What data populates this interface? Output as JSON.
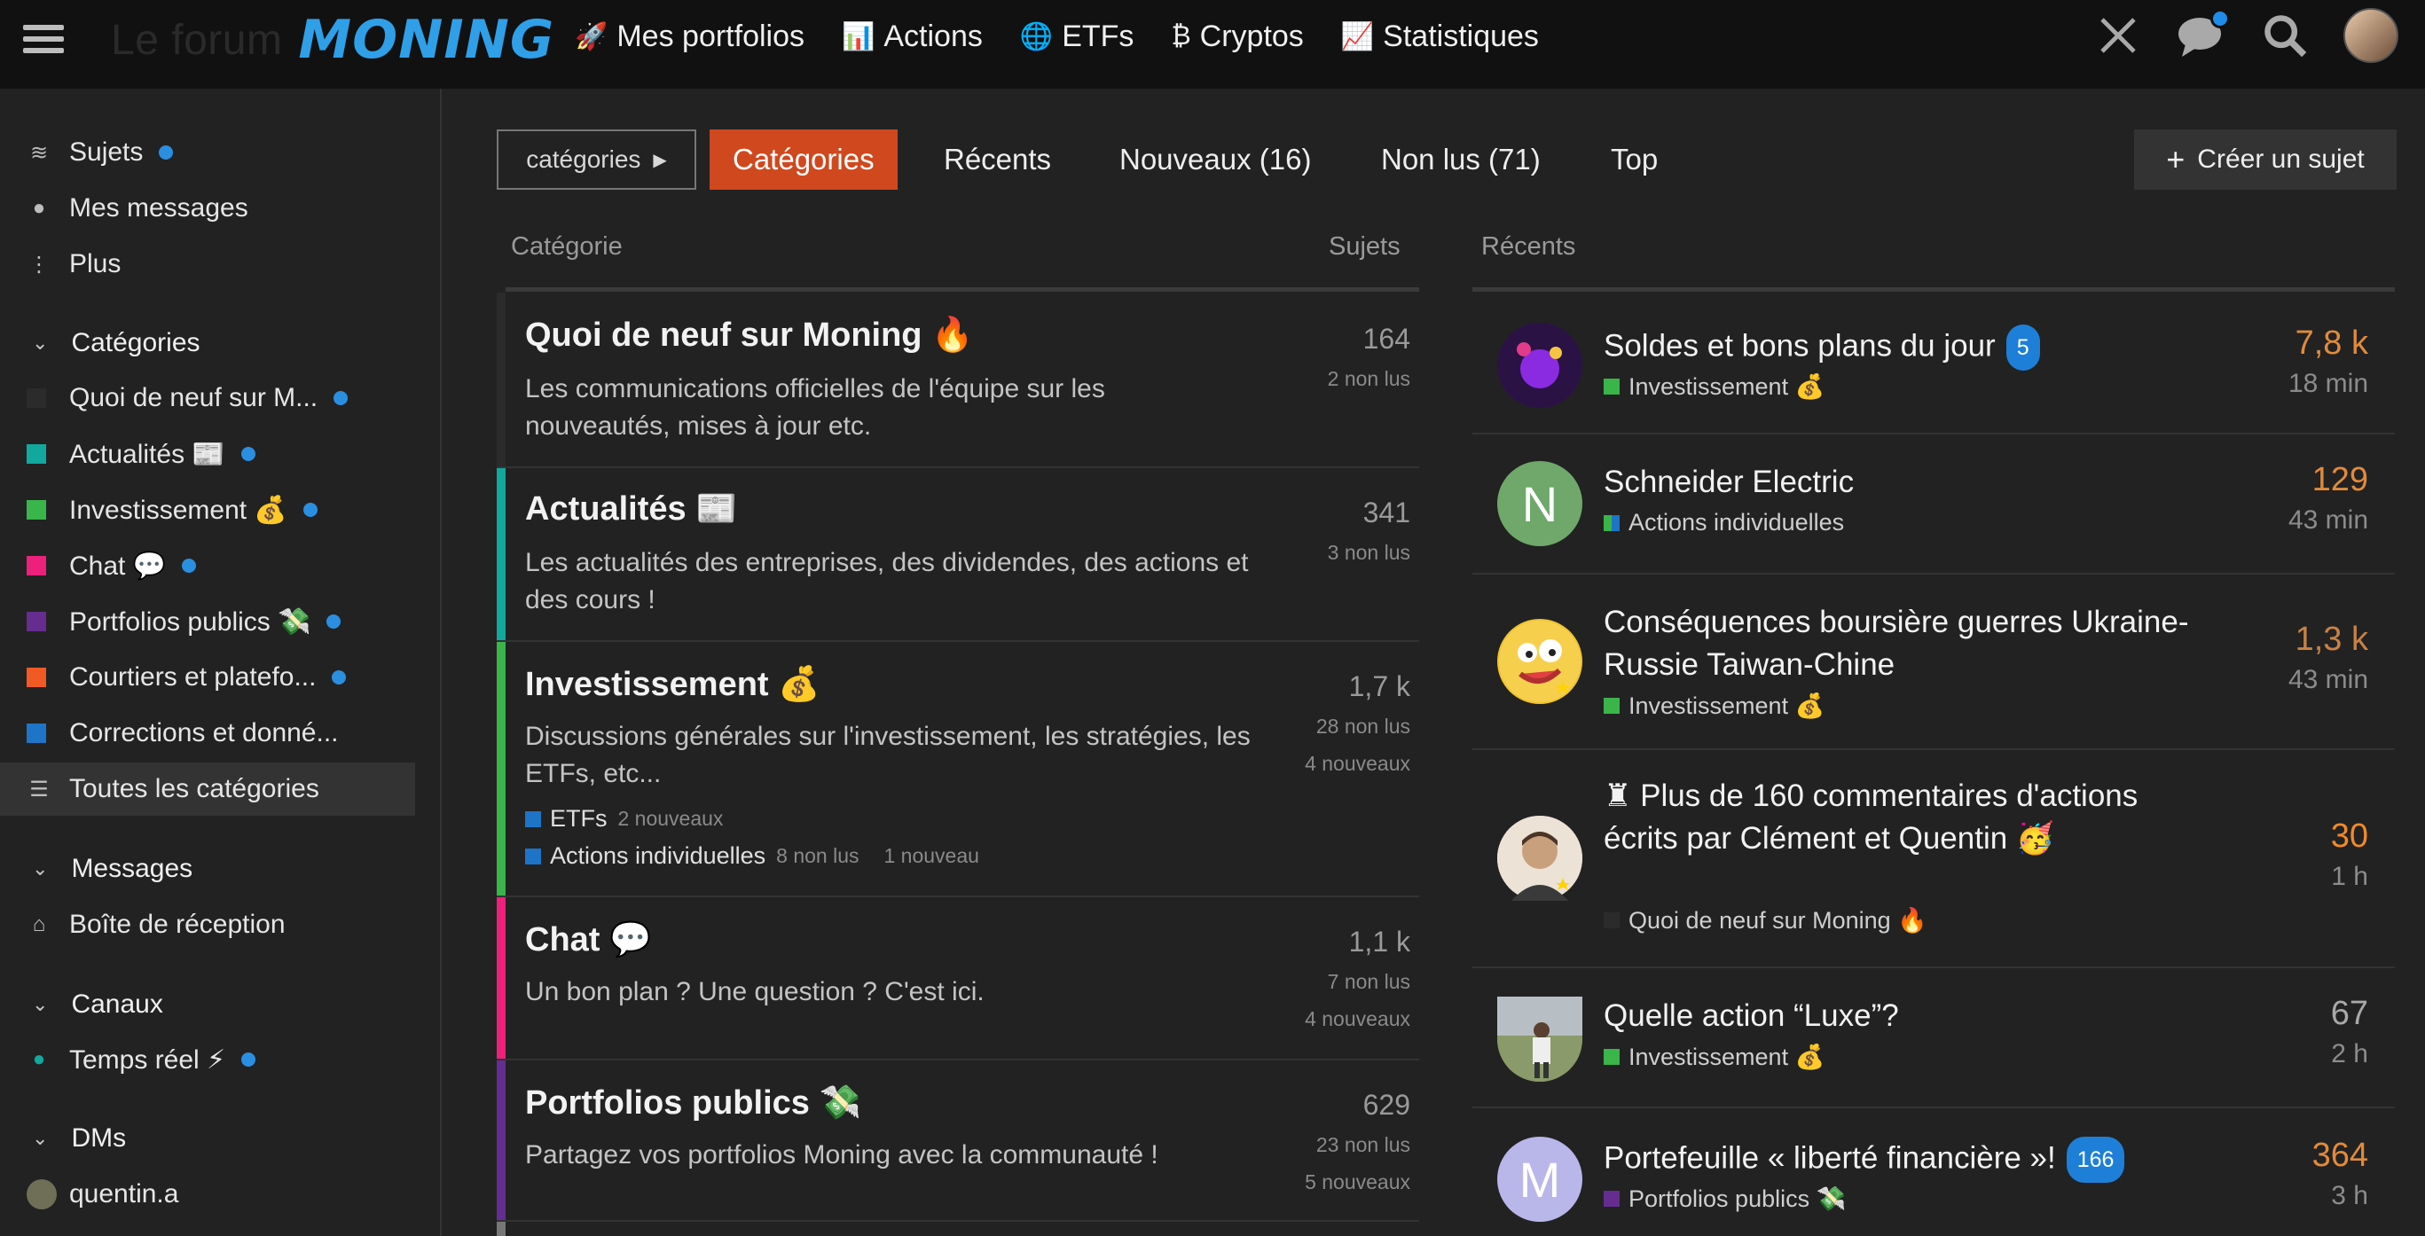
{
  "header": {
    "logo_prefix": "Le forum",
    "logo_brand": "MONING",
    "nav": [
      {
        "icon": "🚀",
        "label": "Mes portfolios"
      },
      {
        "icon": "📊",
        "label": "Actions"
      },
      {
        "icon": "🌐",
        "label": "ETFs"
      },
      {
        "icon": "₿",
        "label": "Cryptos"
      },
      {
        "icon": "📈",
        "label": "Statistiques"
      }
    ]
  },
  "sidebar": {
    "top": [
      {
        "label": "Sujets"
      },
      {
        "label": "Mes messages"
      },
      {
        "label": "Plus"
      }
    ],
    "categories_title": "Catégories",
    "categories": [
      {
        "label": "Quoi de neuf sur M...",
        "color": "#2b2b2b"
      },
      {
        "label": "Actualités 📰",
        "color": "#12a89d"
      },
      {
        "label": "Investissement 💰",
        "color": "#3ab54a"
      },
      {
        "label": "Chat 💬",
        "color": "#ed207b"
      },
      {
        "label": "Portfolios publics 💸",
        "color": "#652d90"
      },
      {
        "label": "Courtiers et platefo...",
        "color": "#f15a24"
      },
      {
        "label": "Corrections et donné...",
        "color": "#1e74c6"
      },
      {
        "label": "Toutes les catégories"
      }
    ],
    "messages_title": "Messages",
    "inbox": "Boîte de réception",
    "channels_title": "Canaux",
    "channel": "Temps réel ⚡",
    "dms_title": "DMs",
    "dm_user": "quentin.a"
  },
  "tabs": {
    "filter": "catégories",
    "items": [
      "Catégories",
      "Récents",
      "Nouveaux (16)",
      "Non lus (71)",
      "Top"
    ],
    "create": "Créer un sujet"
  },
  "columns": {
    "category": "Catégorie",
    "topics": "Sujets",
    "recent": "Récents"
  },
  "categories": [
    {
      "title": "Quoi de neuf sur Moning 🔥",
      "desc": "Les communications officielles de l'équipe sur les nouveautés, mises à jour etc.",
      "count": "164",
      "sub1": "2 non lus",
      "sub2": "",
      "color": "#2b2b2b"
    },
    {
      "title": "Actualités 📰",
      "desc": "Les actualités des entreprises, des dividendes, des actions et des cours !",
      "count": "341",
      "sub1": "3 non lus",
      "sub2": "",
      "color": "#12a89d"
    },
    {
      "title": "Investissement 💰",
      "desc": "Discussions générales sur l'investissement, les stratégies, les ETFs, etc...",
      "count": "1,7 k",
      "sub1": "28 non lus",
      "sub2": "4 nouveaux",
      "color": "#3ab54a",
      "subcats": [
        {
          "label": "ETFs",
          "meta": "2 nouveaux"
        },
        {
          "label": "Actions individuelles",
          "meta": "8 non lus",
          "meta2": "1 nouveau"
        }
      ]
    },
    {
      "title": "Chat 💬",
      "desc": "Un bon plan ? Une question ? C'est ici.",
      "count": "1,1 k",
      "sub1": "7 non lus",
      "sub2": "4 nouveaux",
      "color": "#ed207b"
    },
    {
      "title": "Portfolios publics 💸",
      "desc": "Partagez vos portfolios Moning avec la communauté !",
      "count": "629",
      "sub1": "23 non lus",
      "sub2": "5 nouveaux",
      "color": "#652d90"
    }
  ],
  "topics": [
    {
      "title": "Soldes et bons plans du jour",
      "badge": "5",
      "category": "Investissement 💰",
      "cat_color": "#3ab54a",
      "count": "7,8 k",
      "time": "18 min",
      "count_color": "#e08b3c",
      "avatar_letter": "",
      "avatar_color": "#3b1d5e"
    },
    {
      "title": "Schneider Electric",
      "badge": "",
      "category": "Actions individuelles",
      "cat_color": "#1e74c6",
      "count": "129",
      "time": "43 min",
      "count_color": "#e08b3c",
      "avatar_letter": "N",
      "avatar_color": "#6fa86a"
    },
    {
      "title": "Conséquences boursière guerres Ukraine-Russie Taiwan-Chine",
      "badge": "",
      "category": "Investissement 💰",
      "cat_color": "#3ab54a",
      "count": "1,3 k",
      "time": "43 min",
      "count_color": "#c98245",
      "avatar_letter": "",
      "avatar_color": "#f0c430"
    },
    {
      "title": "♜ Plus de 160 commentaires d'actions écrits par Clément et Quentin 🥳",
      "badge": "",
      "category": "Quoi de neuf sur Moning 🔥",
      "cat_color": "#2b2b2b",
      "count": "30",
      "time": "1 h",
      "count_color": "#f08a2a",
      "avatar_letter": "",
      "avatar_color": "#d9c2a8"
    },
    {
      "title": "Quelle action “Luxe”?",
      "badge": "",
      "category": "Investissement 💰",
      "cat_color": "#3ab54a",
      "count": "67",
      "time": "2 h",
      "count_color": "#a9a9a9",
      "avatar_letter": "",
      "avatar_color": "#5e6b4a"
    },
    {
      "title": "Portefeuille « liberté financière »!",
      "badge": "166",
      "category": "Portfolios publics 💸",
      "cat_color": "#652d90",
      "count": "364",
      "time": "3 h",
      "count_color": "#e08b3c",
      "avatar_letter": "M",
      "avatar_color": "#b9b6ea"
    }
  ]
}
